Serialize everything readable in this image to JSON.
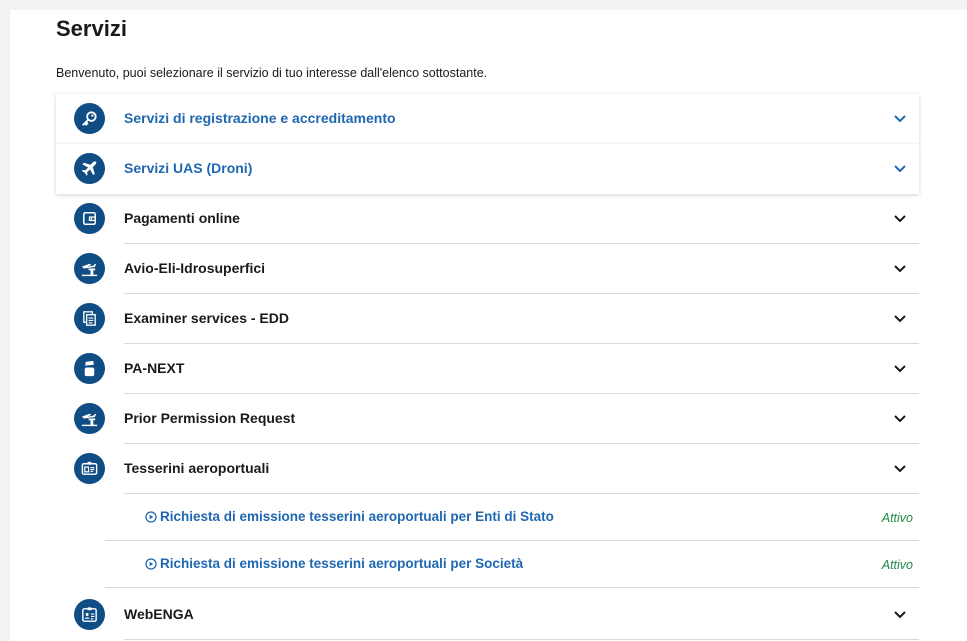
{
  "page": {
    "title": "Servizi",
    "intro": "Benvenuto, puoi selezionare il servizio di tuo interesse dall'elenco sottostante."
  },
  "services": [
    {
      "label": "Servizi di registrazione e accreditamento",
      "icon": "key-icon",
      "style": "card-blue"
    },
    {
      "label": "Servizi UAS (Droni)",
      "icon": "airplane-icon",
      "style": "card-blue"
    },
    {
      "label": "Pagamenti online",
      "icon": "wallet-icon",
      "style": "plain"
    },
    {
      "label": "Avio-Eli-Idrosuperfici",
      "icon": "airfield-icon",
      "style": "plain"
    },
    {
      "label": "Examiner services - EDD",
      "icon": "documents-icon",
      "style": "plain"
    },
    {
      "label": "PA-NEXT",
      "icon": "person-icon",
      "style": "plain"
    },
    {
      "label": "Prior Permission Request",
      "icon": "airfield-icon",
      "style": "plain"
    },
    {
      "label": "Tesserini aeroportuali",
      "icon": "id-badge-icon",
      "style": "plain"
    },
    {
      "label": "WebENGA",
      "icon": "id-card-icon",
      "style": "plain"
    }
  ],
  "tesserini_subitems": [
    {
      "label": "Richiesta di emissione tesserini aeroportuali per Enti di Stato",
      "status": "Attivo"
    },
    {
      "label": "Richiesta di emissione tesserini aeroportuali per Società",
      "status": "Attivo"
    }
  ],
  "colors": {
    "icon_bg": "#114d85",
    "link_blue": "#1f67b1",
    "status_green": "#238a4a"
  }
}
